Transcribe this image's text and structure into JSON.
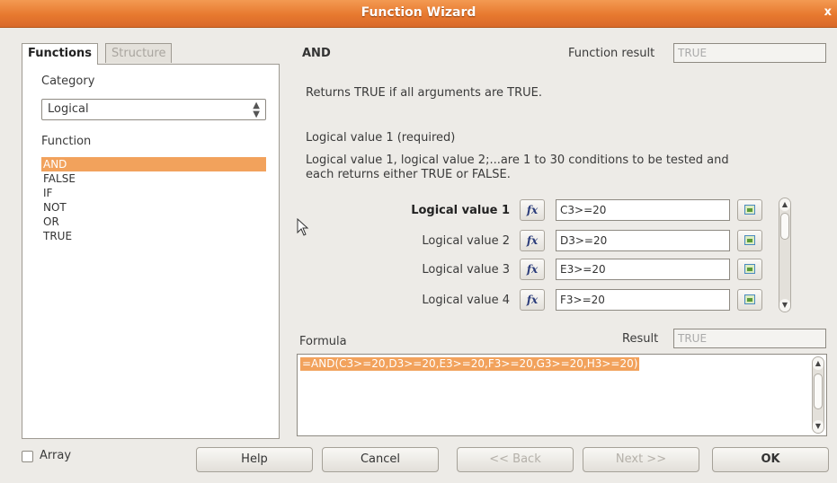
{
  "window": {
    "title": "Function Wizard",
    "close": "x"
  },
  "tabs": {
    "functions": "Functions",
    "structure": "Structure"
  },
  "left": {
    "category_label": "Category",
    "category_value": "Logical",
    "function_label": "Function",
    "functions": [
      "AND",
      "FALSE",
      "IF",
      "NOT",
      "OR",
      "TRUE"
    ],
    "selected_index": 0
  },
  "right": {
    "function_name": "AND",
    "function_result_label": "Function result",
    "function_result_value": "TRUE",
    "description": "Returns TRUE if all arguments are TRUE.",
    "arg_heading": "Logical value 1 (required)",
    "arg_description_line1": "Logical value 1, logical value 2;...are 1 to 30 conditions to be tested and",
    "arg_description_line2": "each returns either TRUE or FALSE.",
    "args": [
      {
        "label": "Logical value 1",
        "value": "C3>=20"
      },
      {
        "label": "Logical value 2",
        "value": "D3>=20"
      },
      {
        "label": "Logical value 3",
        "value": "E3>=20"
      },
      {
        "label": "Logical value 4",
        "value": "F3>=20"
      }
    ],
    "fx_label": "fx",
    "formula_label": "Formula",
    "result_label": "Result",
    "result_value": "TRUE",
    "formula_text": "=AND(C3>=20,D3>=20,E3>=20,F3>=20,G3>=20,H3>=20)"
  },
  "bottom": {
    "array_label": "Array",
    "help": "Help",
    "cancel": "Cancel",
    "back": "<< Back",
    "next": "Next >>",
    "ok": "OK"
  },
  "colors": {
    "titlebar": "#e7792f",
    "selection": "#f2a25c",
    "background": "#edebe7"
  }
}
